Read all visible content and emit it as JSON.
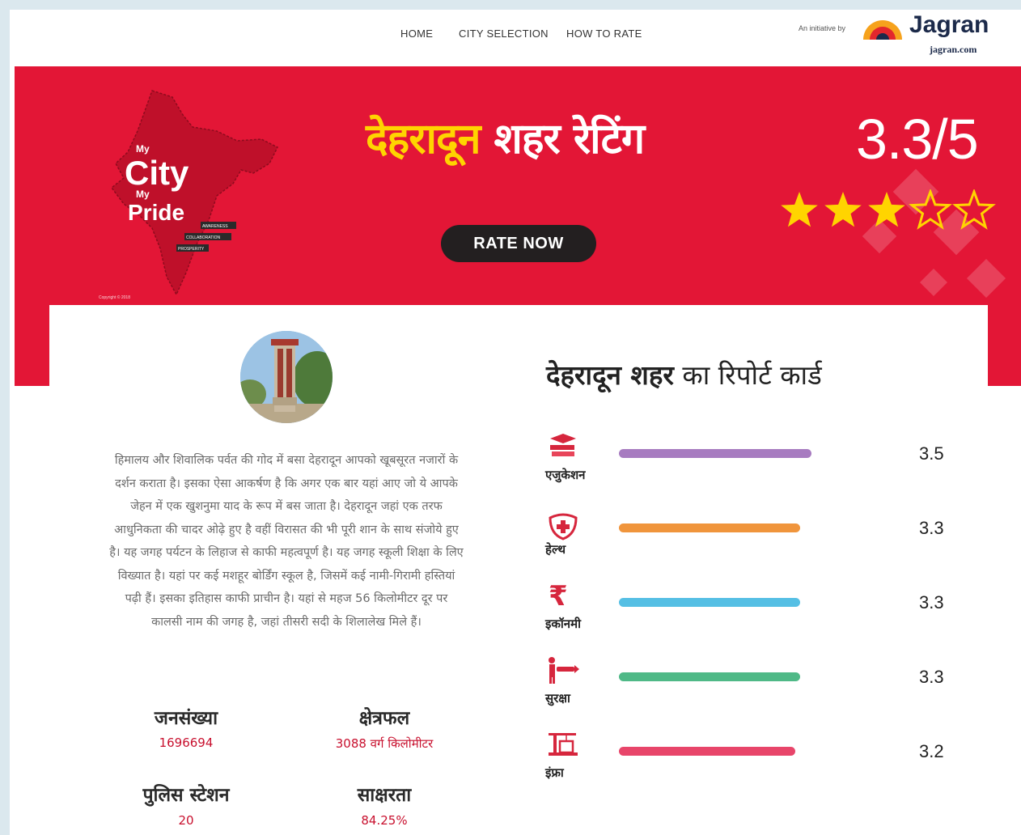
{
  "nav": {
    "links": [
      "HOME",
      "CITY SELECTION",
      "HOW TO RATE"
    ],
    "initiative_label": "An initiative by",
    "brand": "Jagran",
    "brand_domain": "jagran.com"
  },
  "hero": {
    "logo_line1": "My",
    "logo_line2": "City",
    "logo_line3": "My",
    "logo_line4": "Pride",
    "logo_tags": [
      "AWARENESS",
      "COLLABORATION",
      "PROSPERITY"
    ],
    "logo_copyright": "Copyright © 2018",
    "title_city": "देहरादून",
    "title_rest": " शहर रेटिंग",
    "rate_button": "RATE NOW",
    "score": "3.3/5",
    "stars_filled": 3,
    "stars_total": 5,
    "colors": {
      "background": "#e31636",
      "city_title": "#ffd400",
      "button": "#231f20",
      "star": "#ffd400"
    }
  },
  "about": {
    "description": "हिमालय और शिवालिक पर्वत की गोद में बसा देहरादून आपको खूबसूरत नजारों के दर्शन कराता है। इसका ऐसा आकर्षण है कि अगर एक बार यहां आए जो ये आपके जेहन में एक खुशनुमा याद के रूप में बस जाता है। देहरादून जहां एक तरफ आधुनिकता की चादर ओढ़े हुए है वहीं विरासत की भी पूरी शान के साथ संजोये हुए है। यह जगह पर्यटन के लिहाज से काफी महत्वपूर्ण है। यह जगह स्कूली शिक्षा के लिए विख्यात है। यहां पर कई मशहूर बोर्डिंग स्कूल है, जिसमें कई नामी-गिरामी हस्तियां पढ़ी हैं। इसका इतिहास काफी प्राचीन है। यहां से महज 56 किलोमीटर दूर पर कालसी नाम की जगह है, जहां तीसरी सदी के शिलालेख मिले हैं।",
    "stats": [
      {
        "label": "जनसंख्या",
        "value": "1696694"
      },
      {
        "label": "क्षेत्रफल",
        "value": "3088 वर्ग किलोमीटर"
      },
      {
        "label": "पुलिस स्टेशन",
        "value": "20"
      },
      {
        "label": "साक्षरता",
        "value": "84.25%"
      }
    ]
  },
  "report": {
    "title_city": "देहरादून शहर",
    "title_rest": " का रिपोर्ट कार्ड",
    "rows": [
      {
        "icon": "education-icon",
        "label": "एजुकेशन",
        "score": "3.5",
        "color": "#a77bc0"
      },
      {
        "icon": "health-icon",
        "label": "हेल्थ",
        "score": "3.3",
        "color": "#f0953c"
      },
      {
        "icon": "rupee-icon",
        "label": "इकॉनमी",
        "score": "3.3",
        "color": "#55bfe4"
      },
      {
        "icon": "safety-icon",
        "label": "सुरक्षा",
        "score": "3.3",
        "color": "#4fb987"
      },
      {
        "icon": "infrastructure-icon",
        "label": "इंफ्रा",
        "score": "3.2",
        "color": "#e8456a"
      }
    ],
    "scale_max": 5
  }
}
